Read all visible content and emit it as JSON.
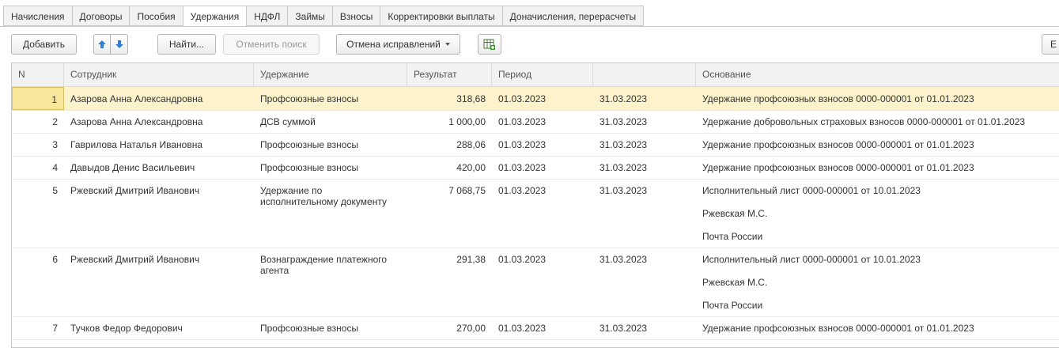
{
  "tabs": [
    "Начисления",
    "Договоры",
    "Пособия",
    "Удержания",
    "НДФЛ",
    "Займы",
    "Взносы",
    "Корректировки выплаты",
    "Доначисления, перерасчеты"
  ],
  "active_tab": "Удержания",
  "toolbar": {
    "add": "Добавить",
    "find": "Найти...",
    "cancel_search": "Отменить поиск",
    "cancel_fixes": "Отмена исправлений",
    "right_button": "Е"
  },
  "columns": {
    "n": "N",
    "employee": "Сотрудник",
    "deduction": "Удержание",
    "result": "Результат",
    "period": "Период",
    "period_end": "",
    "basis": "Основание"
  },
  "rows": [
    {
      "n": "1",
      "employee": "Азарова Анна Александровна",
      "deduction": "Профсоюзные взносы",
      "result": "318,68",
      "from": "01.03.2023",
      "to": "31.03.2023",
      "basis": [
        "Удержание профсоюзных взносов 0000-000001 от 01.01.2023"
      ]
    },
    {
      "n": "2",
      "employee": "Азарова Анна Александровна",
      "deduction": "ДСВ суммой",
      "result": "1 000,00",
      "from": "01.03.2023",
      "to": "31.03.2023",
      "basis": [
        "Удержание добровольных страховых взносов 0000-000001 от 01.01.2023"
      ]
    },
    {
      "n": "3",
      "employee": "Гаврилова Наталья Ивановна",
      "deduction": "Профсоюзные взносы",
      "result": "288,06",
      "from": "01.03.2023",
      "to": "31.03.2023",
      "basis": [
        "Удержание профсоюзных взносов 0000-000001 от 01.01.2023"
      ]
    },
    {
      "n": "4",
      "employee": "Давыдов Денис Васильевич",
      "deduction": "Профсоюзные взносы",
      "result": "420,00",
      "from": "01.03.2023",
      "to": "31.03.2023",
      "basis": [
        "Удержание профсоюзных взносов 0000-000001 от 01.01.2023"
      ]
    },
    {
      "n": "5",
      "employee": "Ржевский Дмитрий Иванович",
      "deduction": "Удержание по исполнительному документу",
      "result": "7 068,75",
      "from": "01.03.2023",
      "to": "31.03.2023",
      "basis": [
        "Исполнительный лист 0000-000001 от 10.01.2023",
        "Ржевская М.С.",
        "Почта России"
      ]
    },
    {
      "n": "6",
      "employee": "Ржевский Дмитрий Иванович",
      "deduction": "Вознаграждение платежного агента",
      "result": "291,38",
      "from": "01.03.2023",
      "to": "31.03.2023",
      "basis": [
        "Исполнительный лист 0000-000001 от 10.01.2023",
        "Ржевская М.С.",
        "Почта России"
      ]
    },
    {
      "n": "7",
      "employee": "Тучков Федор Федорович",
      "deduction": "Профсоюзные взносы",
      "result": "270,00",
      "from": "01.03.2023",
      "to": "31.03.2023",
      "basis": [
        "Удержание профсоюзных взносов 0000-000001 от 01.01.2023"
      ]
    }
  ],
  "colors": {
    "selected_row": "#fcf3cc",
    "arrow_blue": "#2f7fd8",
    "tab_bg": "#f2f2f2"
  }
}
